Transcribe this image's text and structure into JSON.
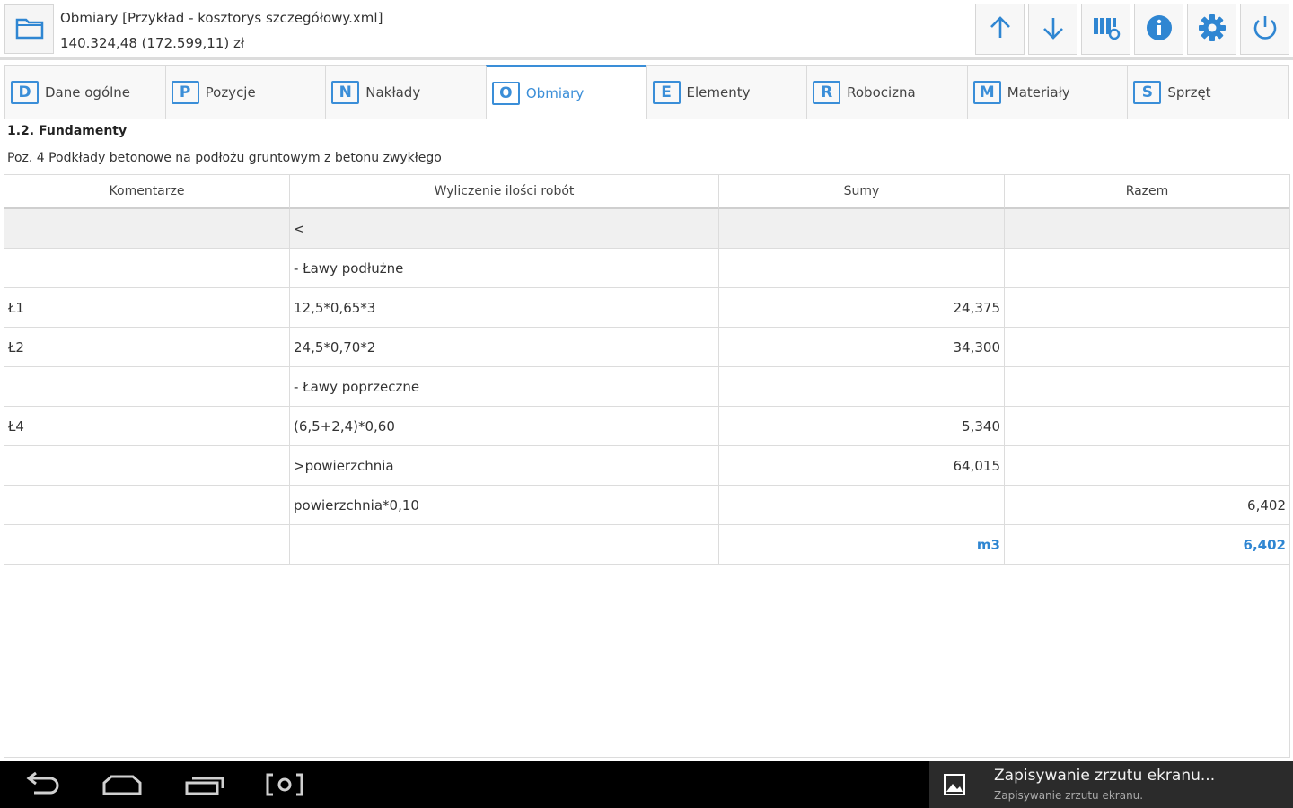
{
  "header": {
    "title": "Obmiary [Przykład - kosztorys szczegółowy.xml]",
    "amount": "140.324,48 (172.599,11) zł"
  },
  "toolbar": {
    "buttons": [
      {
        "icon": "arrow-up-icon"
      },
      {
        "icon": "arrow-down-icon"
      },
      {
        "icon": "columns-settings-icon"
      },
      {
        "icon": "info-icon"
      },
      {
        "icon": "gear-icon"
      },
      {
        "icon": "power-icon"
      }
    ],
    "accent": "#2f86d2"
  },
  "tabs": [
    {
      "letter": "D",
      "label": "Dane ogólne",
      "active": false
    },
    {
      "letter": "P",
      "label": "Pozycje",
      "active": false
    },
    {
      "letter": "N",
      "label": "Nakłady",
      "active": false
    },
    {
      "letter": "O",
      "label": "Obmiary",
      "active": true
    },
    {
      "letter": "E",
      "label": "Elementy",
      "active": false
    },
    {
      "letter": "R",
      "label": "Robocizna",
      "active": false
    },
    {
      "letter": "M",
      "label": "Materiały",
      "active": false
    },
    {
      "letter": "S",
      "label": "Sprzęt",
      "active": false
    }
  ],
  "section": {
    "title": "1.2. Fundamenty",
    "position": "Poz. 4 Podkłady betonowe na podłożu gruntowym z betonu zwykłego"
  },
  "table": {
    "columns": [
      "Komentarze",
      "Wyliczenie ilości robót",
      "Sumy",
      "Razem"
    ],
    "rows": [
      [
        "",
        "<",
        "",
        ""
      ],
      [
        "",
        "- Ławy podłużne",
        "",
        ""
      ],
      [
        "Ł1",
        "12,5*0,65*3",
        "24,375",
        ""
      ],
      [
        "Ł2",
        "24,5*0,70*2",
        "34,300",
        ""
      ],
      [
        "",
        "- Ławy poprzeczne",
        "",
        ""
      ],
      [
        "Ł4",
        "(6,5+2,4)*0,60",
        "5,340",
        ""
      ],
      [
        "",
        ">powierzchnia",
        "64,015",
        ""
      ],
      [
        "",
        "powierzchnia*0,10",
        "",
        "6,402"
      ],
      [
        "",
        "",
        "m3",
        "6,402"
      ]
    ]
  },
  "notification": {
    "title": "Zapisywanie zrzutu ekranu...",
    "subtitle": "Zapisywanie zrzutu ekranu."
  }
}
